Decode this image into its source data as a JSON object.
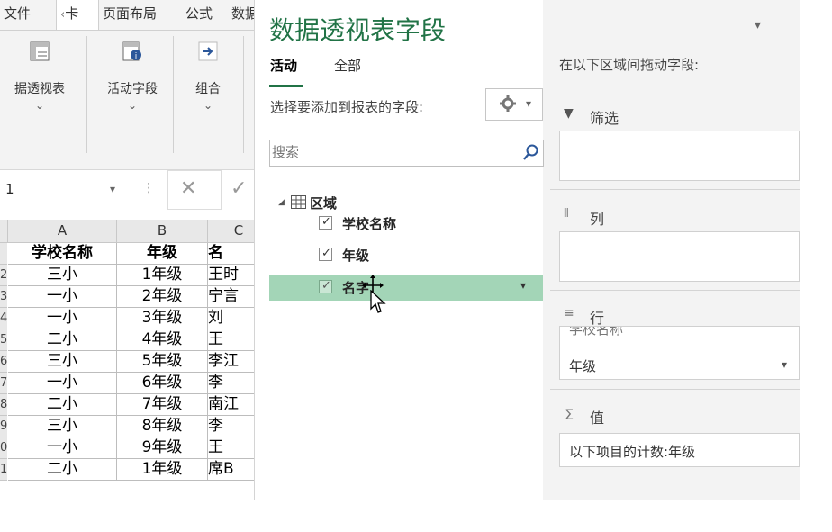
{
  "ribbon": {
    "tabs": [
      "文件",
      "‹",
      "卡",
      "页面布局",
      "公式",
      "数据"
    ],
    "buttons": [
      {
        "label": "据透视表",
        "chev": "⌄"
      },
      {
        "label": "活动字段",
        "chev": "⌄"
      },
      {
        "label": "组合",
        "chev": "⌄"
      }
    ]
  },
  "formula_bar": {
    "name_box": "1",
    "dropdown": "▾",
    "colon": "⋮",
    "cancel": "✕",
    "confirm": "✓"
  },
  "sheet": {
    "columns": [
      "A",
      "B",
      "C"
    ],
    "header_row": [
      "学校名称",
      "年级",
      "名"
    ],
    "rows": [
      [
        "三小",
        "1年级",
        "王时"
      ],
      [
        "一小",
        "2年级",
        "宁言"
      ],
      [
        "一小",
        "3年级",
        "刘"
      ],
      [
        "二小",
        "4年级",
        "王"
      ],
      [
        "三小",
        "5年级",
        "李江"
      ],
      [
        "一小",
        "6年级",
        "李"
      ],
      [
        "二小",
        "7年级",
        "南江"
      ],
      [
        "三小",
        "8年级",
        "李"
      ],
      [
        "一小",
        "9年级",
        "王"
      ],
      [
        "二小",
        "1年级",
        "席B"
      ]
    ],
    "row_numbers": [
      "",
      "2",
      "3",
      "4",
      "5",
      "6",
      "7",
      "8",
      "9",
      "0",
      "1"
    ]
  },
  "pivot_pane": {
    "title": "数据透视表字段",
    "title_dropdown": "▾",
    "tabs": {
      "active": "活动",
      "all": "全部"
    },
    "choose_label": "选择要添加到报表的字段:",
    "gear_dropdown": "▾",
    "search_placeholder": "搜索",
    "tree": {
      "expander": "◢",
      "root": "区域",
      "fields": [
        {
          "name": "学校名称",
          "checked": true
        },
        {
          "name": "年级",
          "checked": true
        },
        {
          "name": "名字",
          "checked": true
        }
      ],
      "row_dropdown": "▾"
    },
    "areas_label": "在以下区域间拖动字段:",
    "areas": {
      "filter": {
        "label": "筛选"
      },
      "columns": {
        "label": "列"
      },
      "rows": {
        "label": "行",
        "items": [
          "学校名称",
          "年级"
        ],
        "dropdown": "▾"
      },
      "values": {
        "label": "值",
        "items": [
          "以下项目的计数:年级"
        ]
      }
    },
    "icons": {
      "filter": "▼",
      "sigma": "Σ",
      "rows": "≡",
      "columns": "⦀"
    }
  },
  "colors": {
    "accent": "#217346",
    "drag_highlight": "#a3d5b7"
  }
}
